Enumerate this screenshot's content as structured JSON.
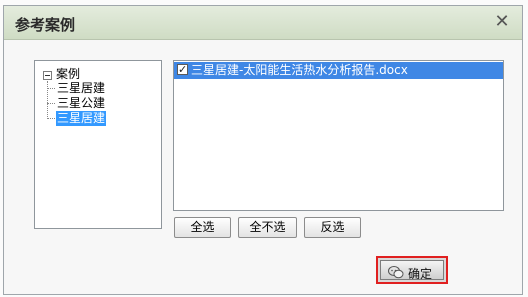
{
  "dialog": {
    "title": "参考案例",
    "close_glyph": "✕"
  },
  "tree": {
    "root_label": "案例",
    "children": [
      {
        "label": "三星居建",
        "selected": false
      },
      {
        "label": "三星公建",
        "selected": false
      },
      {
        "label": "三星居建",
        "selected": true
      }
    ]
  },
  "file_list": {
    "items": [
      {
        "name": "三星居建-太阳能生活热水分析报告.docx",
        "checked": true,
        "check_glyph": "✓"
      }
    ]
  },
  "buttons": {
    "select_all": "全选",
    "select_none": "全不选",
    "invert": "反选",
    "confirm": "确定"
  },
  "icons": {
    "close": "close-icon",
    "checkbox": "checkbox-checked-icon",
    "wechat": "wechat-icon",
    "expander": "tree-collapse-icon"
  },
  "colors": {
    "selection": "#3f87e5",
    "tree_selection": "#3399ff",
    "highlight_border": "#e02020"
  }
}
